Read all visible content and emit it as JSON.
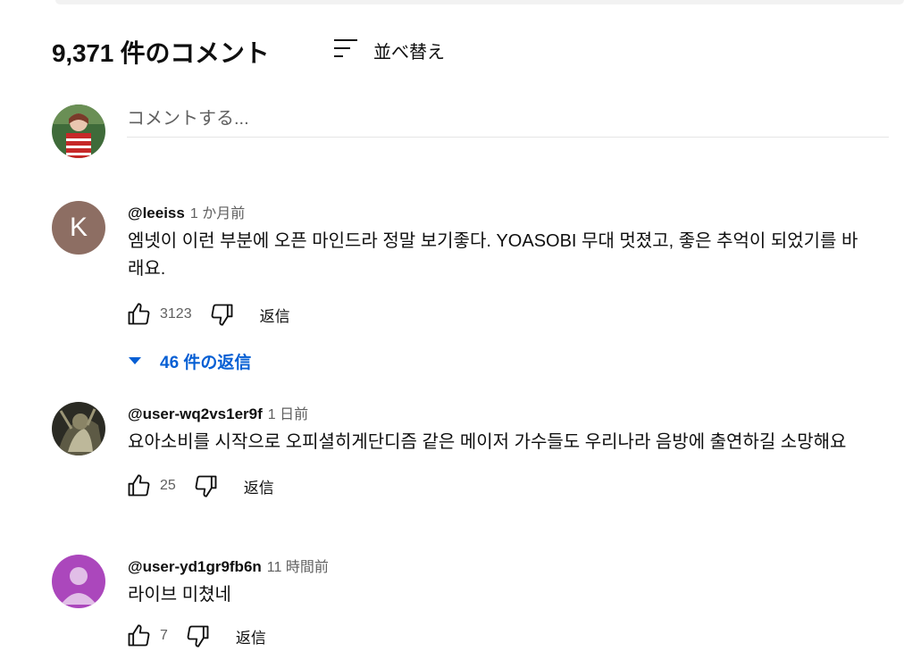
{
  "header": {
    "comment_count": "9,371 件のコメント",
    "sort_label": "並べ替え"
  },
  "composer": {
    "placeholder": "コメントする..."
  },
  "comments": [
    {
      "author": "@leeiss",
      "time": "1 か月前",
      "avatar_letter": "K",
      "avatar_color": "#8d6e63",
      "text": "엠넷이 이런 부분에 오픈 마인드라 정말 보기좋다. YOASOBI 무대 멋졌고, 좋은 추억이 되었기를 바래요.",
      "likes": "3123",
      "reply_label": "返信",
      "replies_label": "46 件の返信"
    },
    {
      "author": "@user-wq2vs1er9f",
      "time": "1 日前",
      "text": "요아소비를 시작으로 오피셜히게단디즘 같은 메이저 가수들도 우리나라 음방에 출연하길 소망해요",
      "likes": "25",
      "reply_label": "返信"
    },
    {
      "author": "@user-yd1gr9fb6n",
      "time": "11 時間前",
      "avatar_color": "#ab47bc",
      "text": "라이브 미쳤네",
      "likes": "7",
      "reply_label": "返信"
    }
  ],
  "colors": {
    "link": "#065fd4",
    "secondary_text": "#606060"
  }
}
